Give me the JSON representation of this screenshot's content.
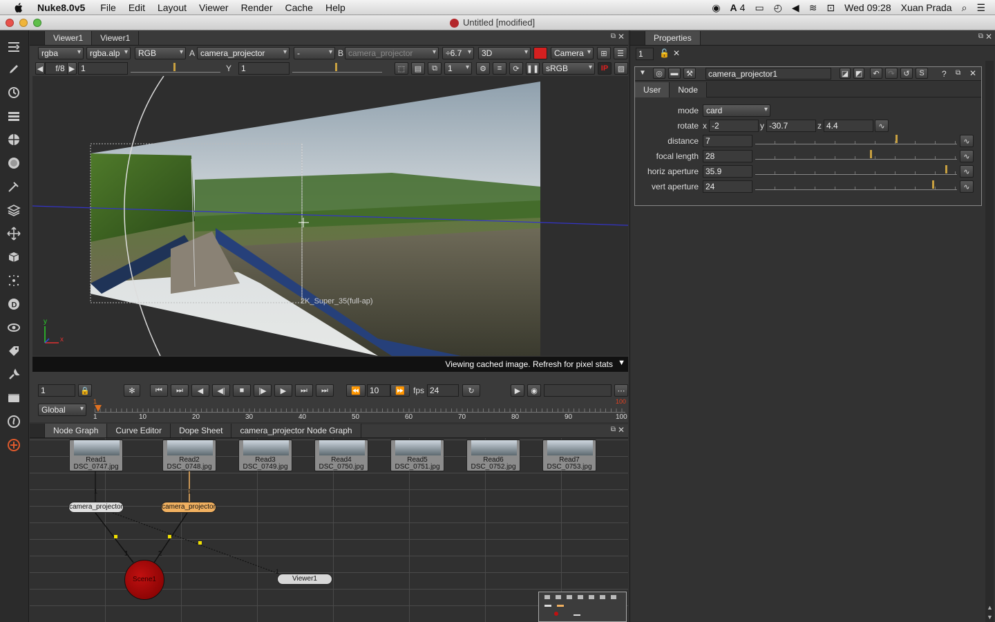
{
  "menubar": {
    "app_name": "Nuke8.0v5",
    "items": [
      "File",
      "Edit",
      "Layout",
      "Viewer",
      "Render",
      "Cache",
      "Help"
    ],
    "status_number": "4",
    "clock": "Wed 09:28",
    "user": "Xuan Prada"
  },
  "window": {
    "title": "Untitled [modified]"
  },
  "viewer": {
    "tabs": [
      "Viewer1",
      "Viewer1"
    ],
    "toolbar1": {
      "channels": "rgba",
      "alpha": "rgba.alp",
      "display": "RGB",
      "a_label": "A",
      "a_input": "camera_projector",
      "wipe": "-",
      "b_label": "B",
      "b_input": "camera_projector",
      "gain": "÷6.7",
      "view_mode": "3D",
      "camera": "Camera"
    },
    "toolbar2": {
      "fstop": "f/8",
      "gain_value": "1",
      "gamma_label": "Y",
      "gamma_value": "1",
      "proxy": "1",
      "lut": "sRGB",
      "ip": "IP"
    },
    "format_label": "2K_Super_35(full-ap)",
    "axis_y": "y",
    "axis_x": "x",
    "status": "Viewing cached image. Refresh for pixel stats"
  },
  "timeline": {
    "frame": "1",
    "step": "10",
    "fps_label": "fps",
    "fps": "24",
    "range": "Global",
    "ticks": [
      "1",
      "10",
      "20",
      "30",
      "40",
      "50",
      "60",
      "70",
      "80",
      "90",
      "100"
    ],
    "start_marker": "1",
    "end_marker": "100"
  },
  "nodegraph": {
    "tabs": [
      "Node Graph",
      "Curve Editor",
      "Dope Sheet",
      "camera_projector Node Graph"
    ],
    "reads": [
      {
        "name": "Read1",
        "file": "DSC_0747.jpg"
      },
      {
        "name": "Read2",
        "file": "DSC_0748.jpg"
      },
      {
        "name": "Read3",
        "file": "DSC_0749.jpg"
      },
      {
        "name": "Read4",
        "file": "DSC_0750.jpg"
      },
      {
        "name": "Read5",
        "file": "DSC_0751.jpg"
      },
      {
        "name": "Read6",
        "file": "DSC_0752.jpg"
      },
      {
        "name": "Read7",
        "file": "DSC_0753.jpg"
      }
    ],
    "projector1": "camera_projector",
    "projector2": "camera_projector",
    "scene": "Scene1",
    "viewer_node": "Viewer1",
    "input1": "1",
    "input2": "2",
    "edge1": "1",
    "edge2": "1",
    "edge3": "1"
  },
  "properties": {
    "title": "Properties",
    "max_panels": "1",
    "node_name": "camera_projector1",
    "tabs": [
      "User",
      "Node"
    ],
    "mode_label": "mode",
    "mode": "card",
    "rotate_label": "rotate",
    "rotate": {
      "x_label": "x",
      "x": "-2",
      "y_label": "y",
      "y": "-30.7",
      "z_label": "z",
      "z": "4.4"
    },
    "rows": [
      {
        "label": "distance",
        "value": "7"
      },
      {
        "label": "focal length",
        "value": "28"
      },
      {
        "label": "horiz aperture",
        "value": "35.9"
      },
      {
        "label": "vert aperture",
        "value": "24"
      }
    ]
  }
}
